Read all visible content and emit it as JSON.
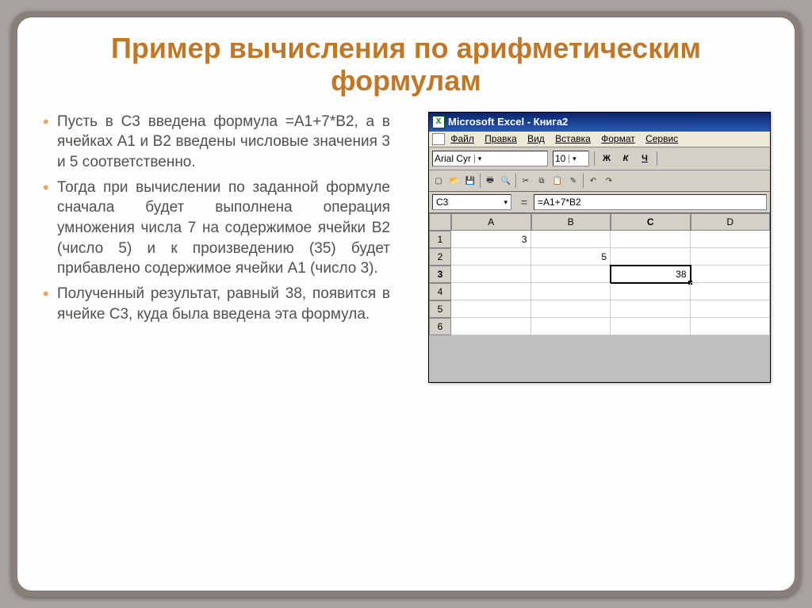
{
  "title": "Пример вычисления по арифметическим формулам",
  "bullets": [
    "Пусть в C3 введена формула =A1+7*B2, а в ячейках A1 и B2 введены числовые значения 3 и 5 соответственно.",
    "Тогда при вычислении по заданной формуле сначала будет выполнена операция умножения числа 7 на содержимое ячейки B2 (число 5) и к произведению (35) будет прибавлено содержимое ячейки A1 (число 3).",
    "Полученный результат, равный 38, появится в ячейке C3, куда была введена эта формула."
  ],
  "excel": {
    "appTitle": "Microsoft Excel - Книга2",
    "menus": [
      "Файл",
      "Правка",
      "Вид",
      "Вставка",
      "Формат",
      "Сервис"
    ],
    "font": {
      "name": "Arial Cyr",
      "size": "10"
    },
    "styleButtons": {
      "bold": "Ж",
      "italic": "К",
      "underline": "Ч"
    },
    "nameBox": "C3",
    "formula": "=A1+7*B2",
    "columns": [
      "A",
      "B",
      "C",
      "D"
    ],
    "rows": [
      "1",
      "2",
      "3",
      "4",
      "5",
      "6"
    ],
    "activeCell": "C3",
    "cells": {
      "A1": "3",
      "B2": "5",
      "C3": "38"
    }
  },
  "chart_data": {
    "type": "table",
    "title": "Microsoft Excel - Книга2",
    "columns": [
      "A",
      "B",
      "C",
      "D"
    ],
    "rows": [
      {
        "row": "1",
        "A": 3,
        "B": null,
        "C": null,
        "D": null
      },
      {
        "row": "2",
        "A": null,
        "B": 5,
        "C": null,
        "D": null
      },
      {
        "row": "3",
        "A": null,
        "B": null,
        "C": 38,
        "D": null
      },
      {
        "row": "4",
        "A": null,
        "B": null,
        "C": null,
        "D": null
      },
      {
        "row": "5",
        "A": null,
        "B": null,
        "C": null,
        "D": null
      },
      {
        "row": "6",
        "A": null,
        "B": null,
        "C": null,
        "D": null
      }
    ],
    "active_cell": "C3",
    "formula_bar": "=A1+7*B2"
  }
}
